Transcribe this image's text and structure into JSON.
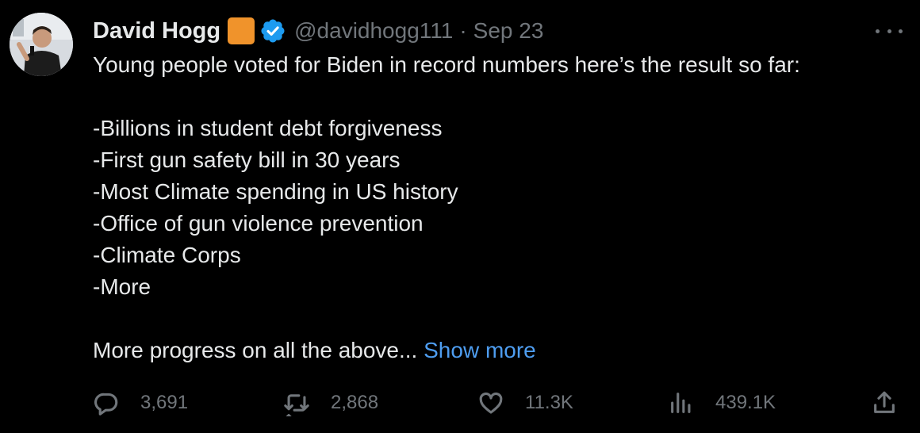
{
  "tweet": {
    "author_name": "David Hogg",
    "handle": "@davidhogg111",
    "separator": "·",
    "date": "Sep 23",
    "lines": [
      "Young people voted for Biden in record numbers here’s the result so far:",
      "",
      "-Billions in student debt forgiveness",
      "-First gun safety bill in 30 years",
      "-Most Climate spending in US history",
      "-Office of gun violence prevention",
      "-Climate Corps",
      "-More",
      ""
    ],
    "last_line": "More progress on all the above... ",
    "show_more": "Show more"
  },
  "actions": {
    "replies": "3,691",
    "retweets": "2,868",
    "likes": "11.3K",
    "views": "439.1K"
  },
  "icons": {
    "emoji": "orange-square-emoji",
    "verified": "verified-badge-icon",
    "more": "more-options-icon",
    "reply": "reply-icon",
    "retweet": "retweet-icon",
    "like": "heart-icon",
    "views": "views-chart-icon",
    "share": "share-icon"
  },
  "colors": {
    "background": "#000000",
    "text": "#e7e9ea",
    "muted": "#71767b",
    "link": "#4e9df0",
    "verified": "#1d9bf0",
    "emoji_square": "#f0932b"
  }
}
